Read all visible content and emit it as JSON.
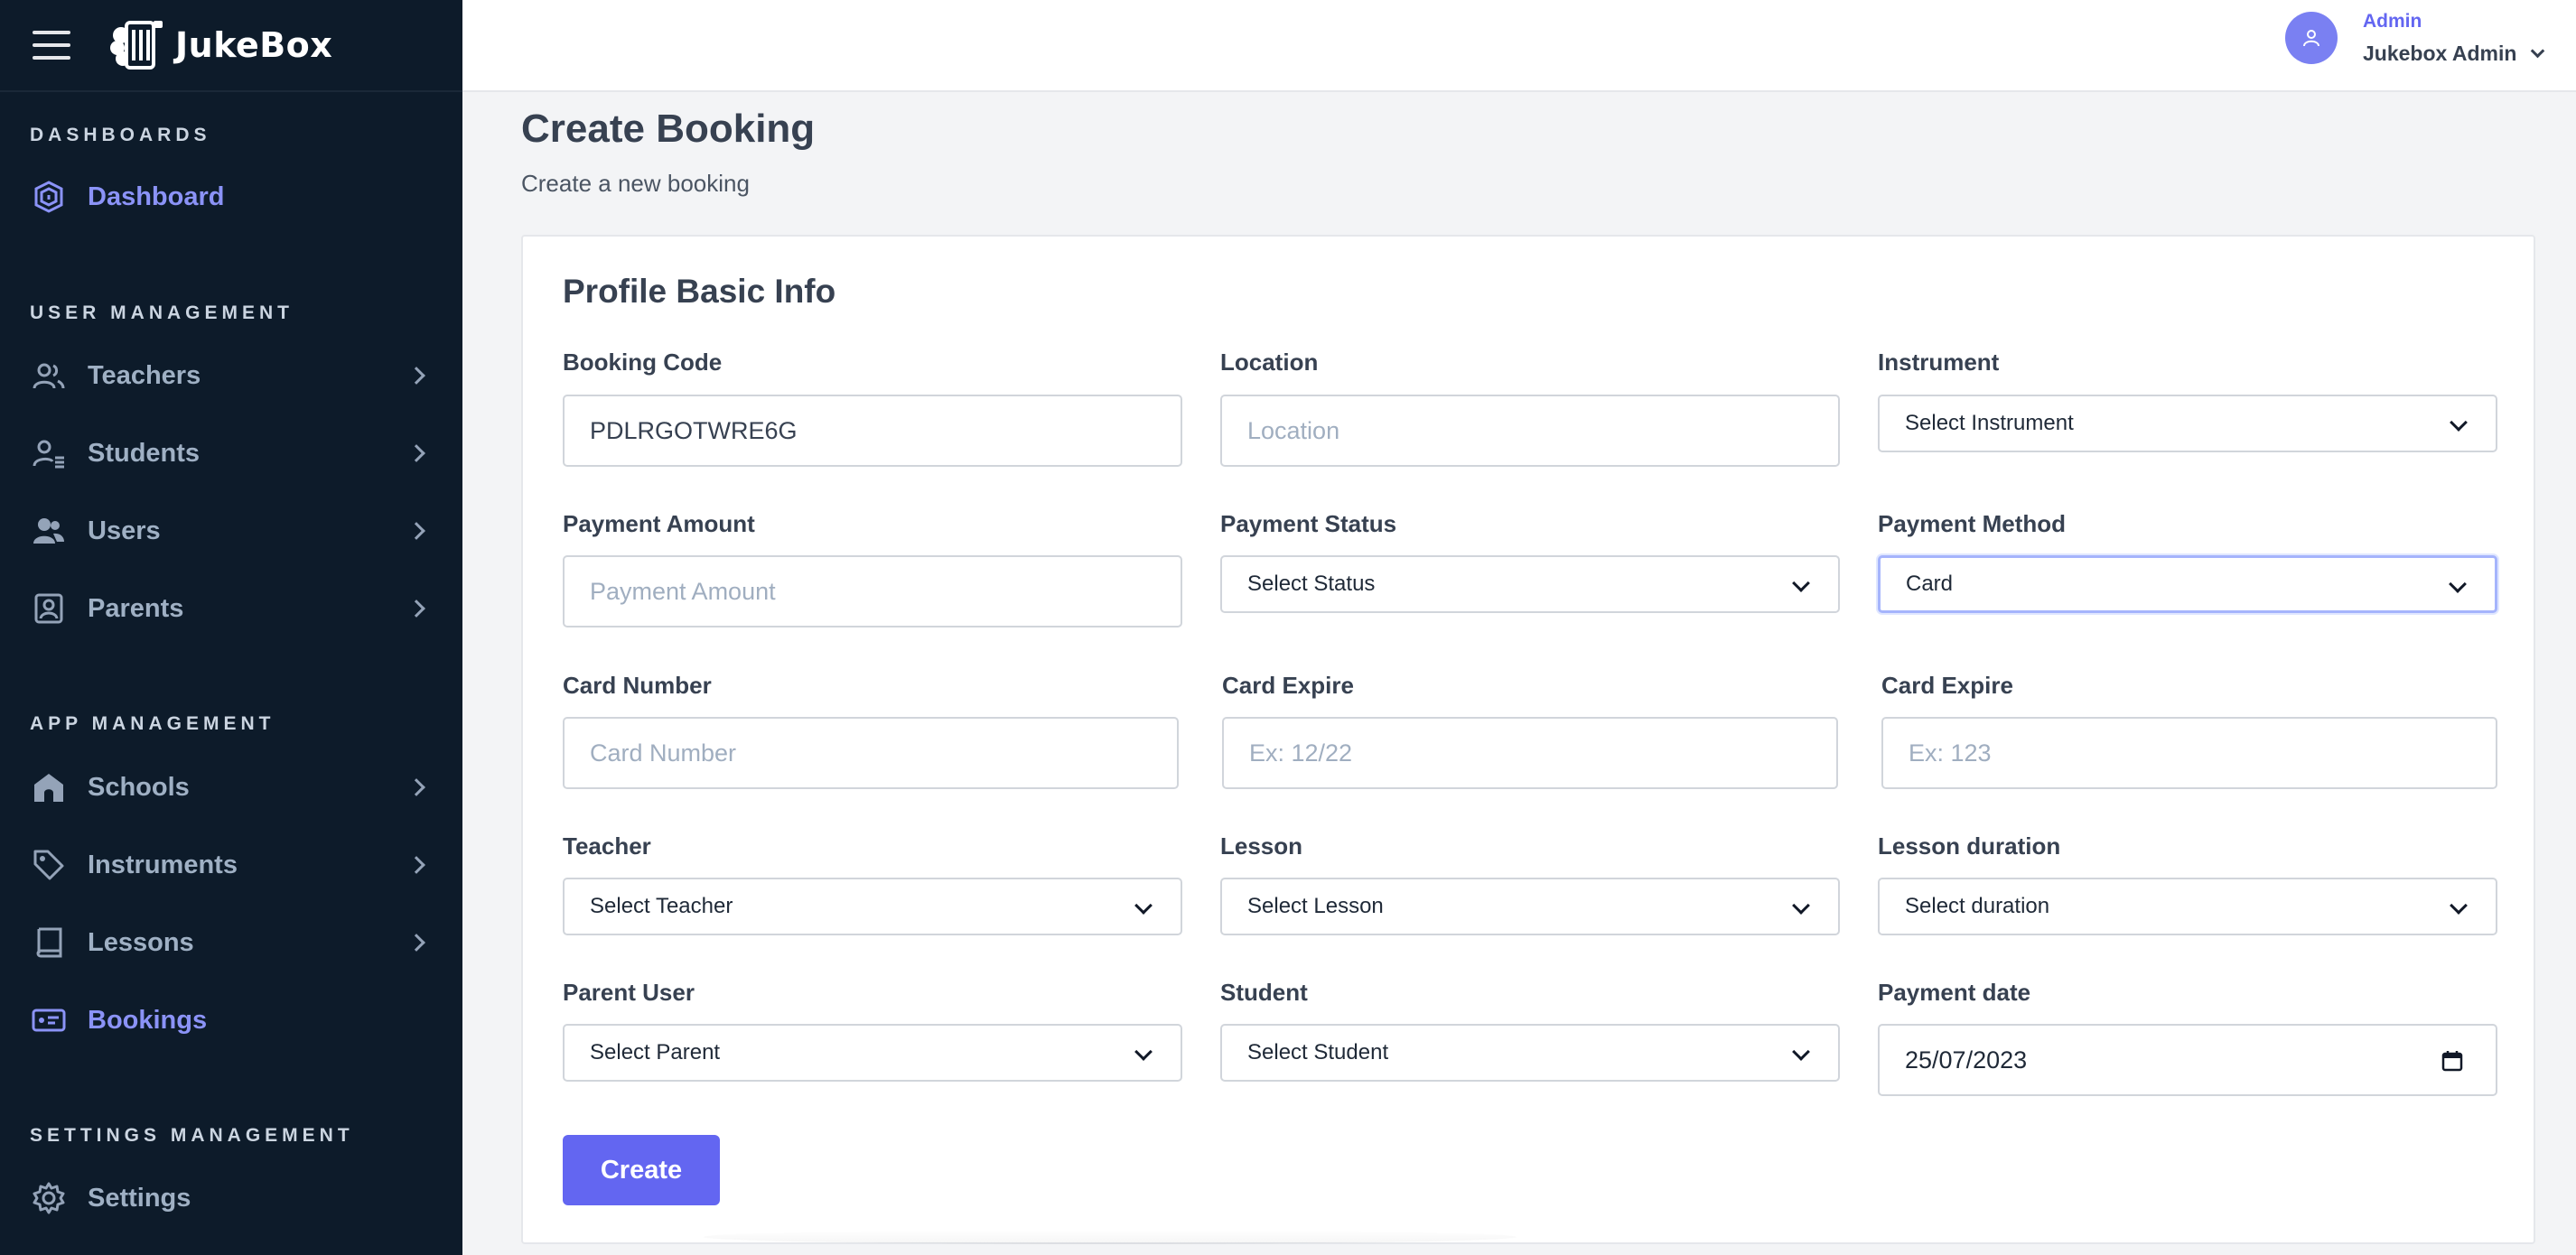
{
  "app": {
    "name": "JukeBox"
  },
  "sidebar": {
    "sections": {
      "dashboards": "DASHBOARDS",
      "user_management": "USER MANAGEMENT",
      "app_management": "APP MANAGEMENT",
      "settings_management": "SETTINGS MANAGEMENT"
    },
    "items": {
      "dashboard": "Dashboard",
      "teachers": "Teachers",
      "students": "Students",
      "users": "Users",
      "parents": "Parents",
      "schools": "Schools",
      "instruments": "Instruments",
      "lessons": "Lessons",
      "bookings": "Bookings",
      "settings": "Settings"
    }
  },
  "header": {
    "user_role": "Admin",
    "user_name": "Jukebox Admin"
  },
  "page": {
    "title": "Create Booking",
    "subtitle": "Create a new booking"
  },
  "form": {
    "title": "Profile Basic Info",
    "booking_code": {
      "label": "Booking Code",
      "value": "PDLRGOTWRE6G"
    },
    "location": {
      "label": "Location",
      "placeholder": "Location"
    },
    "instrument": {
      "label": "Instrument",
      "value": "Select Instrument"
    },
    "payment_amount": {
      "label": "Payment Amount",
      "placeholder": "Payment Amount"
    },
    "payment_status": {
      "label": "Payment Status",
      "value": "Select Status"
    },
    "payment_method": {
      "label": "Payment Method",
      "value": "Card"
    },
    "card_number": {
      "label": "Card Number",
      "placeholder": "Card Number"
    },
    "card_expire": {
      "label": "Card Expire",
      "placeholder": "Ex: 12/22"
    },
    "card_cvc": {
      "label": "Card Expire",
      "placeholder": "Ex: 123"
    },
    "teacher": {
      "label": "Teacher",
      "value": "Select Teacher"
    },
    "lesson": {
      "label": "Lesson",
      "value": "Select Lesson"
    },
    "lesson_duration": {
      "label": "Lesson duration",
      "value": "Select duration"
    },
    "parent_user": {
      "label": "Parent User",
      "value": "Select Parent"
    },
    "student": {
      "label": "Student",
      "value": "Select Student"
    },
    "payment_date": {
      "label": "Payment date",
      "value": "25/07/2023"
    },
    "submit_label": "Create"
  },
  "colors": {
    "sidebar_bg": "#0d1b2a",
    "accent": "#6366f1",
    "active_nav": "#8b93f7"
  }
}
